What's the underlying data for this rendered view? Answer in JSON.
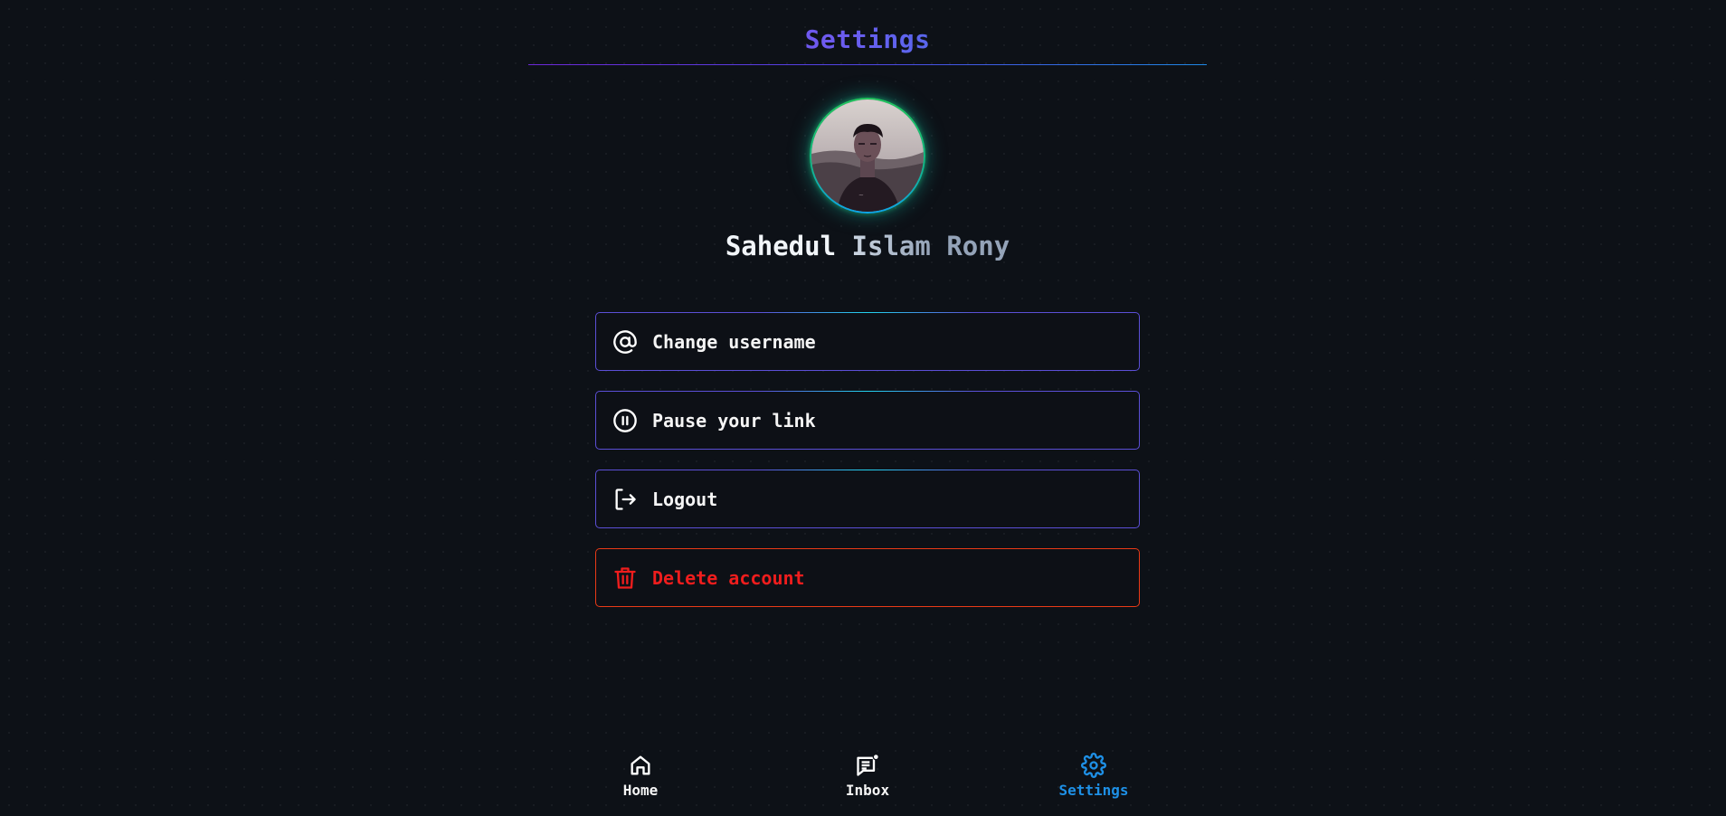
{
  "header": {
    "title": "Settings"
  },
  "profile": {
    "name_part1": "Sahedul",
    "name_part2": "Islam",
    "name_part3": "Rony"
  },
  "menu": {
    "items": [
      {
        "label": "Change username",
        "icon": "at-sign-icon"
      },
      {
        "label": "Pause your link",
        "icon": "pause-circle-icon"
      },
      {
        "label": "Logout",
        "icon": "logout-icon"
      },
      {
        "label": "Delete account",
        "icon": "trash-icon"
      }
    ]
  },
  "nav": {
    "items": [
      {
        "label": "Home",
        "icon": "home-icon"
      },
      {
        "label": "Inbox",
        "icon": "inbox-message-icon"
      },
      {
        "label": "Settings",
        "icon": "gear-icon",
        "active": true
      }
    ]
  },
  "colors": {
    "background": "#0d1117",
    "accent_purple": "#7c3aed",
    "accent_blue": "#1e88e5",
    "danger": "#ef1d1d",
    "nav_active": "#1e90e6"
  }
}
